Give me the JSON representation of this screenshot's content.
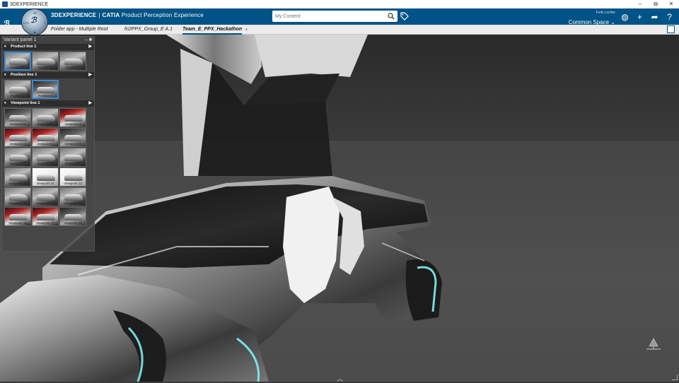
{
  "window": {
    "title": "3DEXPERIENCE",
    "controls": {
      "minimize": "–",
      "restore": "⧉",
      "close": "✕"
    }
  },
  "topbar": {
    "brand_bold": "3DEXPERIENCE",
    "brand_sep": "|",
    "brand_app": "CATIA",
    "brand_suffix": "Product Perception Experience",
    "search_placeholder": "My Content",
    "user_name": "Felix Locher",
    "space_label": "Common Space",
    "accent": "#005386"
  },
  "compass": {
    "quadrants": [
      "3D",
      "V+R",
      "i",
      "▶"
    ]
  },
  "tabs": [
    {
      "label": "Folder app - Multiple Root",
      "active": false
    },
    {
      "label": "fri2PPX_Group_E A.1",
      "active": false
    },
    {
      "label": "Team_E_PPX_Hackathon",
      "active": true
    }
  ],
  "tab_add": "+",
  "panel": {
    "title": "Variant panel 1",
    "minimize": "–",
    "close": "■",
    "product_line": {
      "label": "Product line 1",
      "items": [
        {
          "label": "Product 2",
          "selected": true
        },
        {
          "label": "Product 3",
          "selected": false
        },
        {
          "label": "Product 1",
          "selected": false
        }
      ]
    },
    "position_line": {
      "label": "Position line 1",
      "items": [
        {
          "label": "Position 1",
          "selected": false
        },
        {
          "label": "Position 2",
          "selected": true
        }
      ]
    },
    "viewpoint_line": {
      "label": "Viewpoint line 1",
      "items": [
        {
          "label": "Viewpoint 1",
          "style": "dark"
        },
        {
          "label": "Viewpoint 2",
          "style": ""
        },
        {
          "label": "Viewpoint 3",
          "style": "red"
        },
        {
          "label": "Viewpoint 4",
          "style": "red"
        },
        {
          "label": "Viewpoint 5",
          "style": "red"
        },
        {
          "label": "Viewpoint 6",
          "style": "dark"
        },
        {
          "label": "Viewpoint 7",
          "style": ""
        },
        {
          "label": "Viewpoint 8",
          "style": ""
        },
        {
          "label": "Viewpoint 9",
          "style": ""
        },
        {
          "label": "Viewpoint 10",
          "style": ""
        },
        {
          "label": "Viewpoint 11",
          "style": "white"
        },
        {
          "label": "Viewpoint 12",
          "style": "white"
        },
        {
          "label": "Viewpoint 13",
          "style": ""
        },
        {
          "label": "Viewpoint 14",
          "style": ""
        },
        {
          "label": "Viewpoint 15",
          "style": ""
        },
        {
          "label": "Viewpoint 16",
          "style": "red"
        },
        {
          "label": "Viewpoint 17",
          "style": "red"
        },
        {
          "label": "Viewpoint 18",
          "style": "dark"
        }
      ]
    }
  }
}
